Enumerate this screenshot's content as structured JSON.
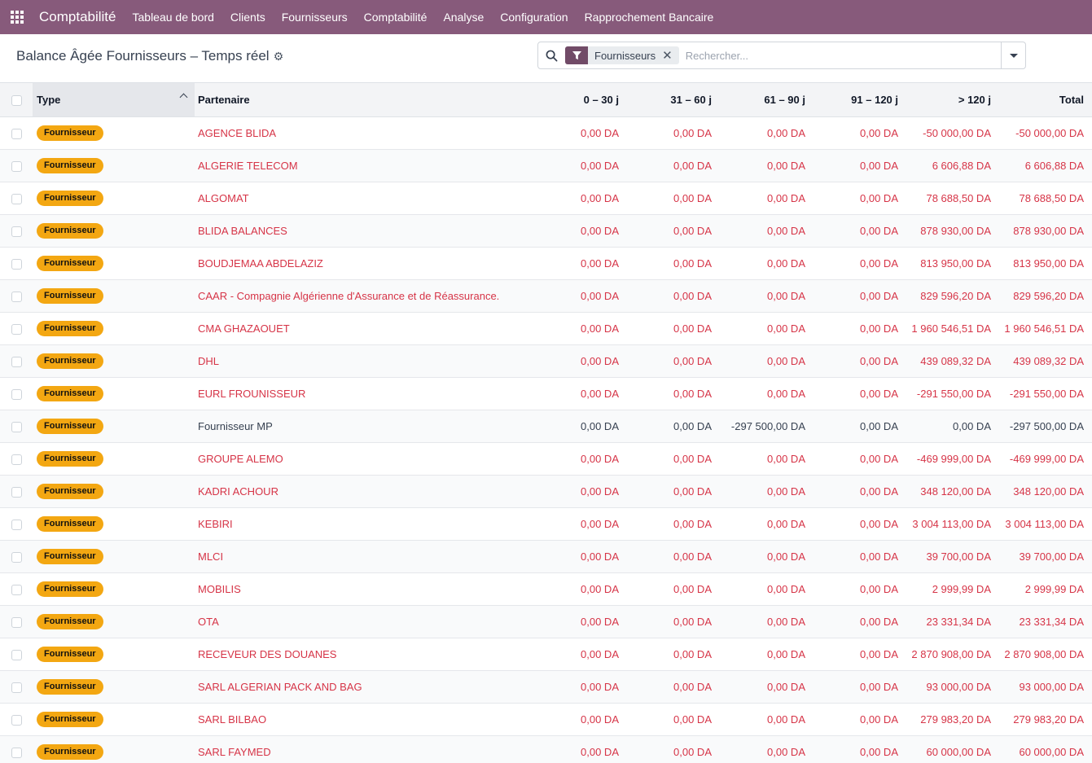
{
  "navbar": {
    "app_name": "Comptabilité",
    "menu": [
      "Tableau de bord",
      "Clients",
      "Fournisseurs",
      "Comptabilité",
      "Analyse",
      "Configuration",
      "Rapprochement Bancaire"
    ]
  },
  "control": {
    "title": "Balance Âgée Fournisseurs – Temps réel",
    "facet_label": "Fournisseurs",
    "search_placeholder": "Rechercher..."
  },
  "table": {
    "headers": {
      "type": "Type",
      "partner": "Partenaire",
      "b0_30": "0 – 30 j",
      "b31_60": "31 – 60 j",
      "b61_90": "61 – 90 j",
      "b91_120": "91 – 120 j",
      "b120": "> 120 j",
      "total": "Total"
    },
    "rows": [
      {
        "type": "Fournisseur",
        "partner": "AGENCE BLIDA",
        "b0": "0,00 DA",
        "b1": "0,00 DA",
        "b2": "0,00 DA",
        "b3": "0,00 DA",
        "b4": "-50 000,00 DA",
        "total": "-50 000,00 DA",
        "red": true
      },
      {
        "type": "Fournisseur",
        "partner": "ALGERIE TELECOM",
        "b0": "0,00 DA",
        "b1": "0,00 DA",
        "b2": "0,00 DA",
        "b3": "0,00 DA",
        "b4": "6 606,88 DA",
        "total": "6 606,88 DA",
        "red": true
      },
      {
        "type": "Fournisseur",
        "partner": "ALGOMAT",
        "b0": "0,00 DA",
        "b1": "0,00 DA",
        "b2": "0,00 DA",
        "b3": "0,00 DA",
        "b4": "78 688,50 DA",
        "total": "78 688,50 DA",
        "red": true
      },
      {
        "type": "Fournisseur",
        "partner": "BLIDA BALANCES",
        "b0": "0,00 DA",
        "b1": "0,00 DA",
        "b2": "0,00 DA",
        "b3": "0,00 DA",
        "b4": "878 930,00 DA",
        "total": "878 930,00 DA",
        "red": true
      },
      {
        "type": "Fournisseur",
        "partner": "BOUDJEMAA ABDELAZIZ",
        "b0": "0,00 DA",
        "b1": "0,00 DA",
        "b2": "0,00 DA",
        "b3": "0,00 DA",
        "b4": "813 950,00 DA",
        "total": "813 950,00 DA",
        "red": true
      },
      {
        "type": "Fournisseur",
        "partner": "CAAR - Compagnie Algérienne d'Assurance et de Réassurance.",
        "b0": "0,00 DA",
        "b1": "0,00 DA",
        "b2": "0,00 DA",
        "b3": "0,00 DA",
        "b4": "829 596,20 DA",
        "total": "829 596,20 DA",
        "red": true
      },
      {
        "type": "Fournisseur",
        "partner": "CMA GHAZAOUET",
        "b0": "0,00 DA",
        "b1": "0,00 DA",
        "b2": "0,00 DA",
        "b3": "0,00 DA",
        "b4": "1 960 546,51 DA",
        "total": "1 960 546,51 DA",
        "red": true
      },
      {
        "type": "Fournisseur",
        "partner": "DHL",
        "b0": "0,00 DA",
        "b1": "0,00 DA",
        "b2": "0,00 DA",
        "b3": "0,00 DA",
        "b4": "439 089,32 DA",
        "total": "439 089,32 DA",
        "red": true
      },
      {
        "type": "Fournisseur",
        "partner": "EURL FROUNISSEUR",
        "b0": "0,00 DA",
        "b1": "0,00 DA",
        "b2": "0,00 DA",
        "b3": "0,00 DA",
        "b4": "-291 550,00 DA",
        "total": "-291 550,00 DA",
        "red": true
      },
      {
        "type": "Fournisseur",
        "partner": "Fournisseur MP",
        "b0": "0,00 DA",
        "b1": "0,00 DA",
        "b2": "-297 500,00 DA",
        "b3": "0,00 DA",
        "b4": "0,00 DA",
        "total": "-297 500,00 DA",
        "red": false
      },
      {
        "type": "Fournisseur",
        "partner": "GROUPE ALEMO",
        "b0": "0,00 DA",
        "b1": "0,00 DA",
        "b2": "0,00 DA",
        "b3": "0,00 DA",
        "b4": "-469 999,00 DA",
        "total": "-469 999,00 DA",
        "red": true
      },
      {
        "type": "Fournisseur",
        "partner": "KADRI ACHOUR",
        "b0": "0,00 DA",
        "b1": "0,00 DA",
        "b2": "0,00 DA",
        "b3": "0,00 DA",
        "b4": "348 120,00 DA",
        "total": "348 120,00 DA",
        "red": true
      },
      {
        "type": "Fournisseur",
        "partner": "KEBIRI",
        "b0": "0,00 DA",
        "b1": "0,00 DA",
        "b2": "0,00 DA",
        "b3": "0,00 DA",
        "b4": "3 004 113,00 DA",
        "total": "3 004 113,00 DA",
        "red": true
      },
      {
        "type": "Fournisseur",
        "partner": "MLCI",
        "b0": "0,00 DA",
        "b1": "0,00 DA",
        "b2": "0,00 DA",
        "b3": "0,00 DA",
        "b4": "39 700,00 DA",
        "total": "39 700,00 DA",
        "red": true
      },
      {
        "type": "Fournisseur",
        "partner": "MOBILIS",
        "b0": "0,00 DA",
        "b1": "0,00 DA",
        "b2": "0,00 DA",
        "b3": "0,00 DA",
        "b4": "2 999,99 DA",
        "total": "2 999,99 DA",
        "red": true
      },
      {
        "type": "Fournisseur",
        "partner": "OTA",
        "b0": "0,00 DA",
        "b1": "0,00 DA",
        "b2": "0,00 DA",
        "b3": "0,00 DA",
        "b4": "23 331,34 DA",
        "total": "23 331,34 DA",
        "red": true
      },
      {
        "type": "Fournisseur",
        "partner": "RECEVEUR DES DOUANES",
        "b0": "0,00 DA",
        "b1": "0,00 DA",
        "b2": "0,00 DA",
        "b3": "0,00 DA",
        "b4": "2 870 908,00 DA",
        "total": "2 870 908,00 DA",
        "red": true
      },
      {
        "type": "Fournisseur",
        "partner": "SARL ALGERIAN PACK AND BAG",
        "b0": "0,00 DA",
        "b1": "0,00 DA",
        "b2": "0,00 DA",
        "b3": "0,00 DA",
        "b4": "93 000,00 DA",
        "total": "93 000,00 DA",
        "red": true
      },
      {
        "type": "Fournisseur",
        "partner": "SARL BILBAO",
        "b0": "0,00 DA",
        "b1": "0,00 DA",
        "b2": "0,00 DA",
        "b3": "0,00 DA",
        "b4": "279 983,20 DA",
        "total": "279 983,20 DA",
        "red": true
      },
      {
        "type": "Fournisseur",
        "partner": "SARL FAYMED",
        "b0": "0,00 DA",
        "b1": "0,00 DA",
        "b2": "0,00 DA",
        "b3": "0,00 DA",
        "b4": "60 000,00 DA",
        "total": "60 000,00 DA",
        "red": true
      }
    ]
  },
  "colors": {
    "navbar": "#875a7b",
    "badge": "#f3a712",
    "overdue_text": "#d63447",
    "facet_icon": "#714b67"
  }
}
